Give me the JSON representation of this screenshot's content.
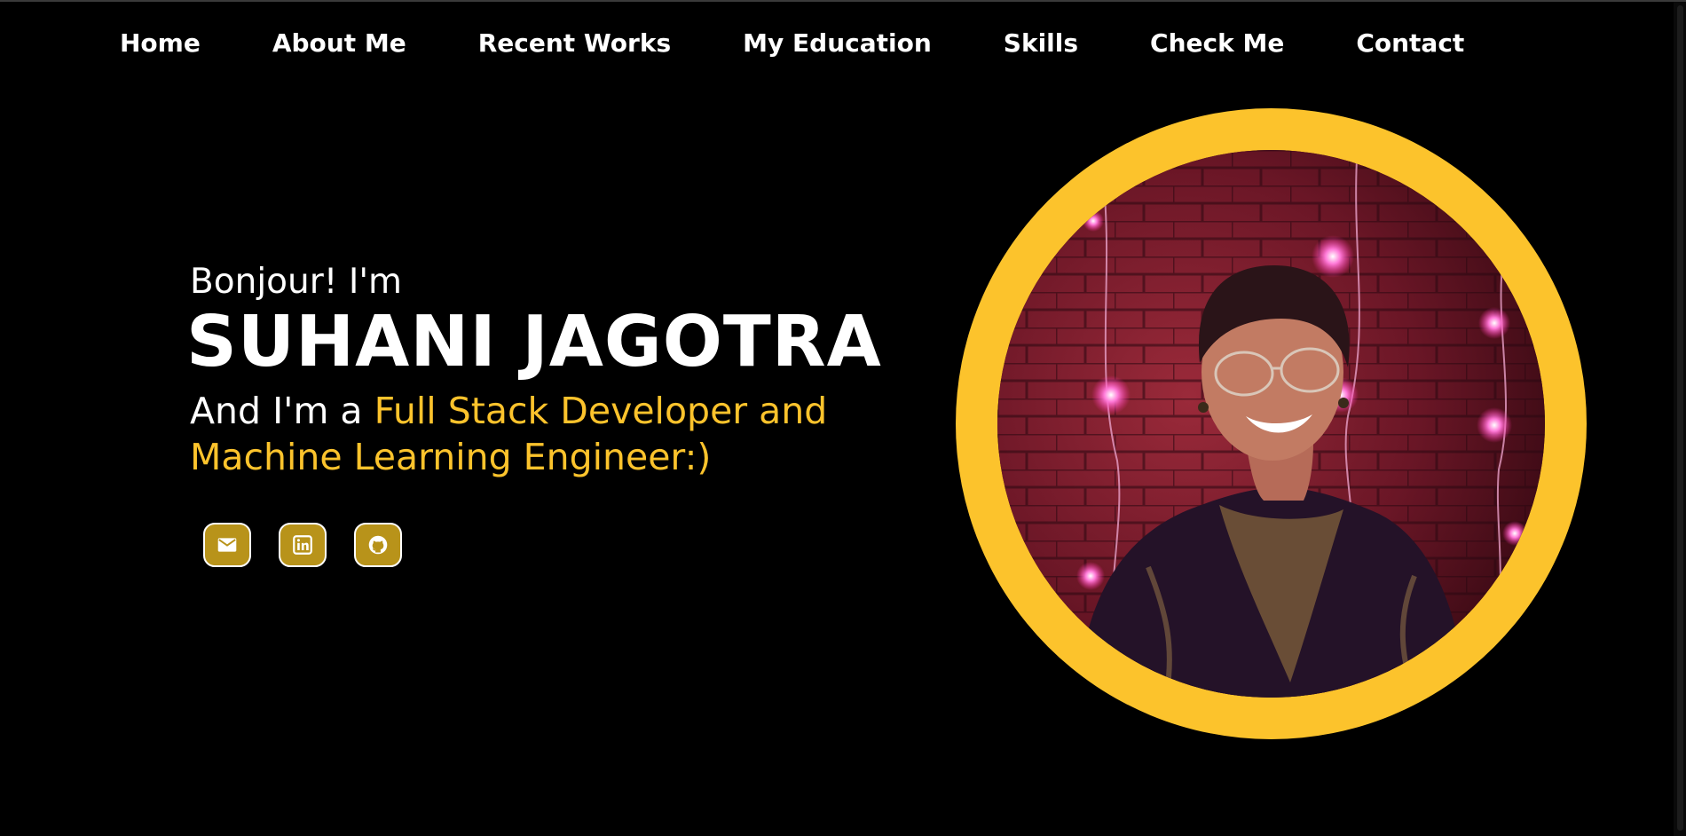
{
  "nav": {
    "items": [
      {
        "label": "Home"
      },
      {
        "label": "About Me"
      },
      {
        "label": "Recent Works"
      },
      {
        "label": "My Education"
      },
      {
        "label": "Skills"
      },
      {
        "label": "Check Me"
      },
      {
        "label": "Contact"
      }
    ]
  },
  "hero": {
    "greeting": "Bonjour! I'm",
    "name": "SUHANI JAGOTRA",
    "role_prefix": "And I'm a ",
    "role_highlight": "Full Stack Developer and Machine Learning Engineer:)"
  },
  "socials": [
    {
      "icon": "mail-icon"
    },
    {
      "icon": "linkedin-icon"
    },
    {
      "icon": "github-icon"
    }
  ],
  "colors": {
    "background": "#000000",
    "accent": "#fcc32c",
    "social_bg": "#b8931a",
    "text": "#ffffff"
  }
}
